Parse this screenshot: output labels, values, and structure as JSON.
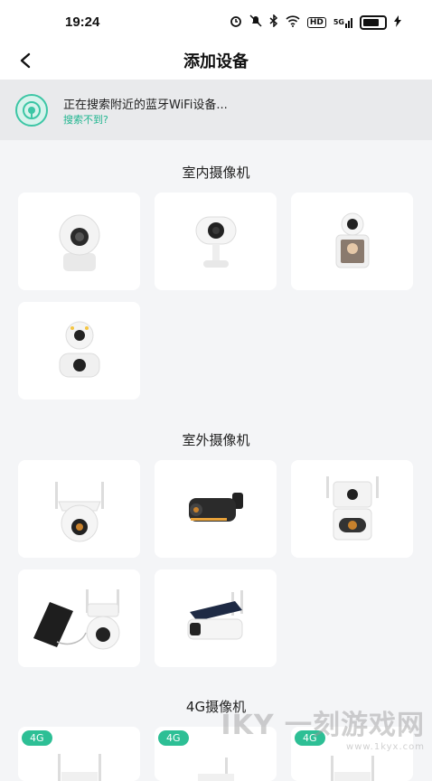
{
  "status_bar": {
    "time": "19:24",
    "icons": [
      "alarm-icon",
      "mute-icon",
      "bluetooth-icon",
      "wifi-icon",
      "hd-icon",
      "signal-5g-icon",
      "battery-icon",
      "charging-icon"
    ],
    "hd_label": "HD",
    "net_label": "5G"
  },
  "header": {
    "title": "添加设备",
    "back_icon": "chevron-left-icon"
  },
  "search_banner": {
    "text": "正在搜索附近的蓝牙WiFi设备...",
    "link": "搜索不到?",
    "accent": "#20b58f"
  },
  "sections": [
    {
      "title": "室内摄像机",
      "devices": [
        "indoor-ptz-camera",
        "indoor-fixed-camera",
        "indoor-video-call-camera",
        "indoor-dual-lens-camera"
      ]
    },
    {
      "title": "室外摄像机",
      "devices": [
        "outdoor-ptz-camera",
        "outdoor-bullet-camera",
        "outdoor-dual-lens-camera",
        "outdoor-solar-ptz-camera",
        "outdoor-solar-bullet-camera"
      ]
    },
    {
      "title": "4G摄像机",
      "badge": "4G",
      "devices": [
        "4g-camera-1",
        "4g-camera-2",
        "4g-camera-3"
      ]
    }
  ],
  "watermark": {
    "text": "IKY 一刻游戏网",
    "url": "www.1kyx.com"
  }
}
